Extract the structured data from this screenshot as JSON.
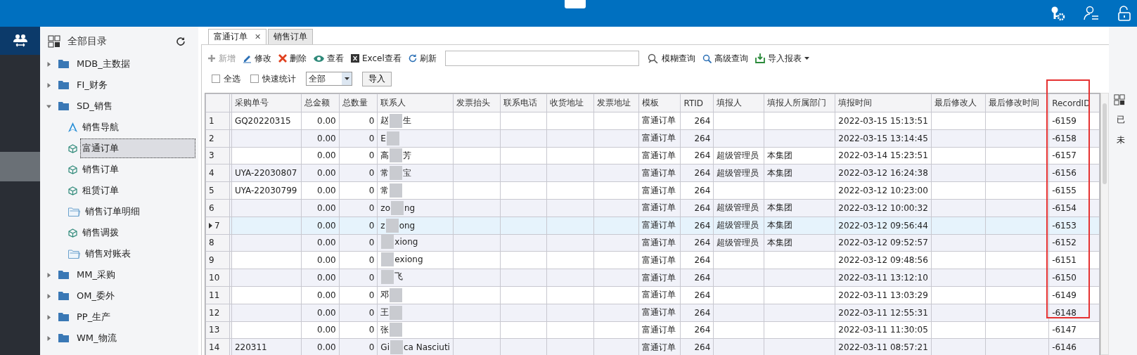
{
  "sidebar": {
    "title": "全部目录",
    "items": [
      {
        "label": "MDB_主数据",
        "expanded": false
      },
      {
        "label": "FI_财务",
        "expanded": false
      },
      {
        "label": "SD_销售",
        "expanded": true,
        "children": [
          {
            "label": "销售导航",
            "kind": "navigation",
            "selected": false
          },
          {
            "label": "富通订单",
            "kind": "form",
            "selected": true
          },
          {
            "label": "销售订单",
            "kind": "form",
            "selected": false
          },
          {
            "label": "租赁订单",
            "kind": "form",
            "selected": false
          },
          {
            "label": "销售订单明细",
            "kind": "folder",
            "selected": false
          },
          {
            "label": "销售调拨",
            "kind": "form",
            "selected": false
          },
          {
            "label": "销售对账表",
            "kind": "folder",
            "selected": false
          }
        ]
      },
      {
        "label": "MM_采购",
        "expanded": false
      },
      {
        "label": "OM_委外",
        "expanded": false
      },
      {
        "label": "PP_生产",
        "expanded": false
      },
      {
        "label": "WM_物流",
        "expanded": false
      }
    ]
  },
  "tabs": [
    {
      "label": "富通订单",
      "selected": true,
      "close": "✕"
    },
    {
      "label": "销售订单",
      "selected": false
    }
  ],
  "toolbar": [
    {
      "kind": "add",
      "label": "新增",
      "disabled": true
    },
    {
      "kind": "edit",
      "label": "修改",
      "disabled": false
    },
    {
      "kind": "delete",
      "label": "删除",
      "disabled": false
    },
    {
      "kind": "view",
      "label": "查看",
      "disabled": false
    },
    {
      "kind": "excel",
      "label": "Excel查看",
      "disabled": false
    },
    {
      "kind": "refresh",
      "label": "刷新",
      "disabled": false
    },
    {
      "kind": "search_field"
    },
    {
      "kind": "fuzzy",
      "label": "模糊查询",
      "disabled": false
    },
    {
      "kind": "advanced",
      "label": "高级查询",
      "disabled": false
    },
    {
      "kind": "import",
      "label": "导入报表",
      "disabled": false
    }
  ],
  "filters": {
    "select_all": {
      "label": "全选",
      "checked": false
    },
    "quick_stats": {
      "label": "快速统计",
      "checked": false
    },
    "scope": {
      "value": "全部"
    },
    "import_button": "导入"
  },
  "table": {
    "columns": [
      "采购单号",
      "总金额",
      "总数量",
      "联系人",
      "发票抬头",
      "联系电话",
      "收货地址",
      "发票地址",
      "模板",
      "RTID",
      "填报人",
      "填报人所属部门",
      "填报时间",
      "最后修改人",
      "最后修改时间",
      "RecordID"
    ],
    "rows": [
      {
        "n": "1",
        "current": false,
        "selected": false,
        "order": "GQ20220315",
        "amount": "0.00",
        "qty": "0",
        "contact": {
          "before": "赵",
          "after": "生"
        },
        "template": "富通订单",
        "rtid": "264",
        "filler": "",
        "dept": "",
        "time": "2022-03-15 15:13:51",
        "record": "-6159"
      },
      {
        "n": "2",
        "current": false,
        "selected": false,
        "order": "",
        "amount": "0.00",
        "qty": "0",
        "contact": {
          "before": "E"
        },
        "template": "富通订单",
        "rtid": "264",
        "filler": "",
        "dept": "",
        "time": "2022-03-15 13:14:45",
        "record": "-6158"
      },
      {
        "n": "3",
        "current": false,
        "selected": false,
        "order": "",
        "amount": "0.00",
        "qty": "0",
        "contact": {
          "before": "高",
          "after": "芳"
        },
        "template": "富通订单",
        "rtid": "264",
        "filler": "超级管理员",
        "dept": "本集团",
        "time": "2022-03-14 15:23:51",
        "record": "-6157"
      },
      {
        "n": "4",
        "current": false,
        "selected": false,
        "order": "UYA-22030807",
        "amount": "0.00",
        "qty": "0",
        "contact": {
          "before": "常",
          "after": "宝"
        },
        "template": "富通订单",
        "rtid": "264",
        "filler": "超级管理员",
        "dept": "本集团",
        "time": "2022-03-12 16:24:38",
        "record": "-6156"
      },
      {
        "n": "5",
        "current": false,
        "selected": false,
        "order": "UYA-22030799",
        "amount": "0.00",
        "qty": "0",
        "contact": {
          "before": "常"
        },
        "template": "富通订单",
        "rtid": "264",
        "filler": "",
        "dept": "",
        "time": "2022-03-12 10:23:00",
        "record": "-6155"
      },
      {
        "n": "6",
        "current": false,
        "selected": false,
        "order": "",
        "amount": "0.00",
        "qty": "0",
        "contact": {
          "before": "zo",
          "after": "ng"
        },
        "template": "富通订单",
        "rtid": "264",
        "filler": "超级管理员",
        "dept": "本集团",
        "time": "2022-03-12 10:00:32",
        "record": "-6154"
      },
      {
        "n": "7",
        "current": true,
        "selected": true,
        "order": "",
        "amount": "0.00",
        "qty": "0",
        "contact": {
          "before": "z",
          "after": "ong"
        },
        "template": "富通订单",
        "rtid": "264",
        "filler": "超级管理员",
        "dept": "本集团",
        "time": "2022-03-12 09:56:44",
        "record": "-6153"
      },
      {
        "n": "8",
        "current": false,
        "selected": false,
        "order": "",
        "amount": "0.00",
        "qty": "0",
        "contact": {
          "after": "xiong"
        },
        "template": "富通订单",
        "rtid": "264",
        "filler": "超级管理员",
        "dept": "本集团",
        "time": "2022-03-12 09:52:57",
        "record": "-6152"
      },
      {
        "n": "9",
        "current": false,
        "selected": false,
        "order": "",
        "amount": "0.00",
        "qty": "0",
        "contact": {
          "after": "exiong"
        },
        "template": "富通订单",
        "rtid": "264",
        "filler": "",
        "dept": "",
        "time": "2022-03-12 09:48:56",
        "record": "-6151"
      },
      {
        "n": "10",
        "current": false,
        "selected": false,
        "order": "",
        "amount": "0.00",
        "qty": "0",
        "contact": {
          "after": "飞"
        },
        "template": "富通订单",
        "rtid": "264",
        "filler": "",
        "dept": "",
        "time": "2022-03-11 13:12:10",
        "record": "-6150"
      },
      {
        "n": "11",
        "current": false,
        "selected": false,
        "order": "",
        "amount": "0.00",
        "qty": "0",
        "contact": {
          "before": "邓"
        },
        "template": "富通订单",
        "rtid": "264",
        "filler": "",
        "dept": "",
        "time": "2022-03-11 13:03:29",
        "record": "-6149"
      },
      {
        "n": "12",
        "current": false,
        "selected": false,
        "order": "",
        "amount": "0.00",
        "qty": "0",
        "contact": {
          "before": "王"
        },
        "template": "富通订单",
        "rtid": "264",
        "filler": "",
        "dept": "",
        "time": "2022-03-11 12:55:31",
        "record": "-6148"
      },
      {
        "n": "13",
        "current": false,
        "selected": false,
        "order": "",
        "amount": "0.00",
        "qty": "0",
        "contact": {
          "before": "张"
        },
        "template": "富通订单",
        "rtid": "264",
        "filler": "",
        "dept": "",
        "time": "2022-03-11 11:30:05",
        "record": "-6147"
      },
      {
        "n": "14",
        "current": false,
        "selected": false,
        "order": "220311",
        "amount": "0.00",
        "qty": "0",
        "contact": {
          "before": "Gi",
          "after": "ca Nasciuti"
        },
        "template": "富通订单",
        "rtid": "264",
        "filler": "",
        "dept": "",
        "time": "2022-03-11 08:57:21",
        "record": "-6146"
      }
    ]
  },
  "side_panel": {
    "items": [
      "已",
      "未"
    ]
  }
}
